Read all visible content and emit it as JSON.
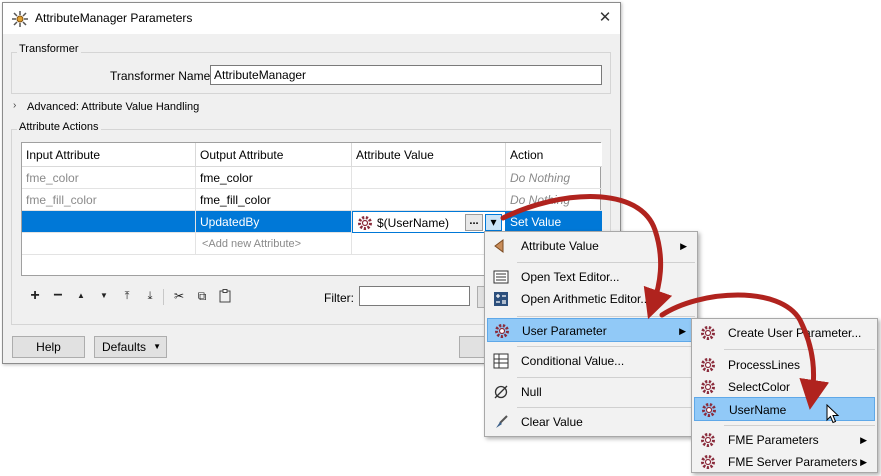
{
  "dialog": {
    "title": "AttributeManager Parameters",
    "close_glyph": "✕",
    "transformer_group": "Transformer",
    "transformer_name_label": "Transformer Name:",
    "transformer_name_value": "AttributeManager",
    "advanced_label": "Advanced: Attribute Value Handling",
    "actions_group": "Attribute Actions"
  },
  "table": {
    "headers": [
      "Input Attribute",
      "Output Attribute",
      "Attribute Value",
      "Action"
    ],
    "rows": [
      {
        "input": "fme_color",
        "output": "fme_color",
        "value": "",
        "action": "Do Nothing"
      },
      {
        "input": "fme_fill_color",
        "output": "fme_fill_color",
        "value": "",
        "action": "Do Nothing"
      },
      {
        "input": "",
        "output": "UpdatedBy",
        "value": "$(UserName)",
        "action": "Set Value"
      }
    ],
    "add_placeholder": "<Add new Attribute>",
    "ellipsis": "...",
    "dropdown_glyph": "▾"
  },
  "toolbar": {
    "add": "+",
    "remove": "−",
    "up": "▲",
    "down": "▼",
    "top": "⤒",
    "bottom": "⤓",
    "cut": "✂",
    "copy": "⧉",
    "paste": "📋",
    "filter_label": "Filter:"
  },
  "footer": {
    "help": "Help",
    "defaults": "Defaults",
    "defaults_caret": "▼"
  },
  "menu1": {
    "items": [
      {
        "label": "Attribute Value",
        "icon": "attribute-value-icon",
        "submenu": true
      },
      {
        "label": "Open Text Editor...",
        "icon": "text-editor-icon",
        "submenu": false
      },
      {
        "label": "Open Arithmetic Editor...",
        "icon": "arithmetic-editor-icon",
        "submenu": false
      },
      {
        "label": "User Parameter",
        "icon": "user-parameter-icon",
        "submenu": true
      },
      {
        "label": "Conditional Value...",
        "icon": "conditional-value-icon",
        "submenu": false
      },
      {
        "label": "Null",
        "icon": "null-icon",
        "submenu": false
      },
      {
        "label": "Clear Value",
        "icon": "clear-value-icon",
        "submenu": false
      }
    ],
    "arrow": "▶"
  },
  "menu2": {
    "items": [
      {
        "label": "Create User Parameter...",
        "icon": "gear-icon"
      },
      {
        "label": "ProcessLines",
        "icon": "gear-icon"
      },
      {
        "label": "SelectColor",
        "icon": "gear-icon"
      },
      {
        "label": "UserName",
        "icon": "gear-icon"
      },
      {
        "label": "FME Parameters",
        "icon": "gear-icon"
      },
      {
        "label": "FME Server Parameters",
        "icon": "gear-icon"
      }
    ],
    "arrow": "▶"
  },
  "colors": {
    "selection": "#0078d7",
    "menu_highlight": "#91c9f7",
    "annotation_arrow": "#b0231e"
  }
}
